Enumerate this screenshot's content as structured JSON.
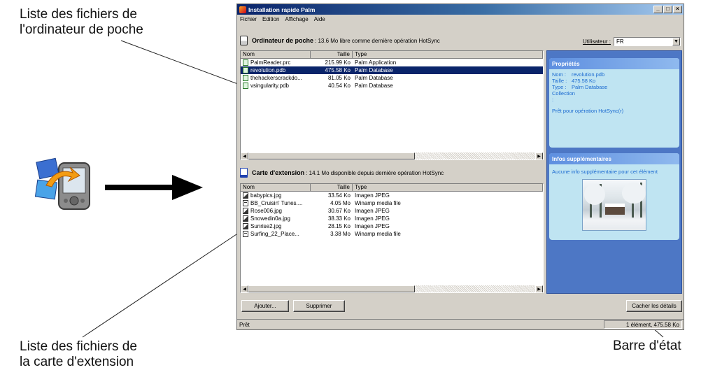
{
  "callouts": {
    "handheld_list_line1": "Liste des fichiers de",
    "handheld_list_line2": "l'ordinateur de poche",
    "card_list_line1": "Liste des fichiers de",
    "card_list_line2": "la carte d'extension",
    "status_bar": "Barre d'état"
  },
  "window": {
    "title": "Installation rapide Palm",
    "controls": {
      "minimize": "_",
      "maximize": "□",
      "close": "×"
    },
    "menu": [
      "Fichier",
      "Edition",
      "Affichage",
      "Aide"
    ]
  },
  "handheld": {
    "label": "Ordinateur de poche",
    "info": ": 13.6 Mo libre comme dernière opération HotSync",
    "user_label": "Utilisateur :",
    "user_value": "FR",
    "columns": [
      "Nom",
      "Taille",
      "Type"
    ],
    "files": [
      {
        "name": "PalmReader.prc",
        "size": "215.99 Ko",
        "type": "Palm Application",
        "selected": false
      },
      {
        "name": "revolution.pdb",
        "size": "475.58 Ko",
        "type": "Palm Database",
        "selected": true
      },
      {
        "name": "thehackerscrackdo...",
        "size": "81.05 Ko",
        "type": "Palm Database",
        "selected": false
      },
      {
        "name": "vsingularity.pdb",
        "size": "40.54 Ko",
        "type": "Palm Database",
        "selected": false
      }
    ]
  },
  "card": {
    "label": "Carte d'extension",
    "info": ": 14.1 Mo disponible depuis dernière opération HotSync",
    "columns": [
      "Nom",
      "Taille",
      "Type"
    ],
    "files": [
      {
        "name": "babypics.jpg",
        "size": "33.54 Ko",
        "type": "Imagen JPEG",
        "kind": "image"
      },
      {
        "name": "BB_Cruisin' Tunes....",
        "size": "4.05 Mo",
        "type": "Winamp media file",
        "kind": "audio"
      },
      {
        "name": "Rose006.jpg",
        "size": "30.67 Ko",
        "type": "Imagen JPEG",
        "kind": "image"
      },
      {
        "name": "Snowedin0a.jpg",
        "size": "38.33 Ko",
        "type": "Imagen JPEG",
        "kind": "image"
      },
      {
        "name": "Sunrise2.jpg",
        "size": "28.15 Ko",
        "type": "Imagen JPEG",
        "kind": "image"
      },
      {
        "name": "Surfing_22_Place...",
        "size": "3.38 Mo",
        "type": "Winamp media file",
        "kind": "audio"
      }
    ]
  },
  "properties": {
    "title": "Propriétés",
    "fields": [
      {
        "label": "Nom :",
        "value": "revolution.pdb"
      },
      {
        "label": "Taille :",
        "value": "475.58 Ko"
      },
      {
        "label": "Type :",
        "value": "Palm Database"
      },
      {
        "label": "Collection :",
        "value": ""
      }
    ],
    "status": "Prêt pour opération HotSync(r)"
  },
  "extra_info": {
    "title": "Infos supplémentaires",
    "text": "Aucune info supplémentaire pour cet élément"
  },
  "buttons": {
    "add": "Ajouter...",
    "remove": "Supprimer",
    "hide_details": "Cacher les détails"
  },
  "statusbar": {
    "left": "Prêt",
    "right": "1 élément, 475.58 Ko"
  },
  "colors": {
    "titlebar": "#0a246a",
    "selection": "#0a246a",
    "side_panel": "#4d77c5",
    "side_box": "#bfe4f2"
  }
}
